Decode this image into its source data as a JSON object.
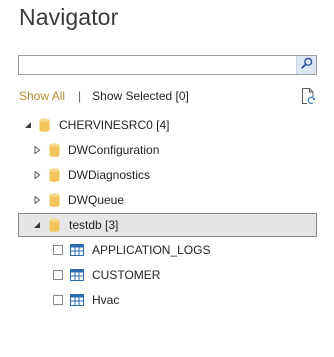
{
  "title": "Navigator",
  "search": {
    "value": "",
    "placeholder": "",
    "button_icon": "search-icon"
  },
  "links": {
    "show_all": "Show All",
    "separator": "|",
    "show_selected": "Show Selected [0]"
  },
  "refresh_icon": "refresh-document-icon",
  "tree": {
    "root": {
      "label": "CHERVINESRC0 [4]",
      "expanded": true
    },
    "databases": [
      {
        "label": "DWConfiguration",
        "expanded": false
      },
      {
        "label": "DWDiagnostics",
        "expanded": false
      },
      {
        "label": "DWQueue",
        "expanded": false
      },
      {
        "label": "testdb [3]",
        "expanded": true,
        "selected": true
      }
    ],
    "tables": [
      {
        "label": "APPLICATION_LOGS",
        "checked": false
      },
      {
        "label": "CUSTOMER",
        "checked": false
      },
      {
        "label": "Hvac",
        "checked": false
      }
    ]
  },
  "colors": {
    "accent_link": "#b88a2c",
    "db_icon": "#f2c45a",
    "table_icon": "#2b6cb0"
  }
}
